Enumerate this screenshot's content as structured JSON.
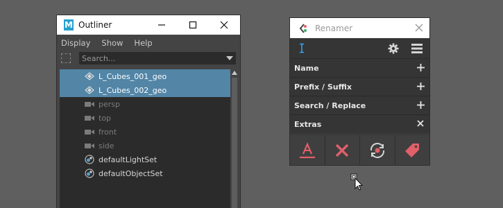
{
  "outliner": {
    "title": "Outliner",
    "logo_letter": "M",
    "menus": [
      "Display",
      "Show",
      "Help"
    ],
    "search_placeholder": "Search...",
    "items": [
      {
        "label": "L_Cubes_001_geo",
        "kind": "geo",
        "selected": true
      },
      {
        "label": "L_Cubes_002_geo",
        "kind": "geo",
        "selected": true
      },
      {
        "label": "persp",
        "kind": "camera",
        "selected": false
      },
      {
        "label": "top",
        "kind": "camera",
        "selected": false
      },
      {
        "label": "front",
        "kind": "camera",
        "selected": false
      },
      {
        "label": "side",
        "kind": "camera",
        "selected": false
      },
      {
        "label": "defaultLightSet",
        "kind": "set",
        "selected": false
      },
      {
        "label": "defaultObjectSet",
        "kind": "set",
        "selected": false
      }
    ]
  },
  "renamer": {
    "title": "Renamer",
    "sections": [
      {
        "label": "Name",
        "action": "plus"
      },
      {
        "label": "Prefix / Suffix",
        "action": "plus"
      },
      {
        "label": "Search / Replace",
        "action": "plus"
      },
      {
        "label": "Extras",
        "action": "close"
      }
    ],
    "tools": [
      "text-underline-icon",
      "delete-x-icon",
      "refresh-gear-icon",
      "tag-icon"
    ],
    "accent": "#e0606a",
    "cursor_accent": "#33aaff"
  }
}
